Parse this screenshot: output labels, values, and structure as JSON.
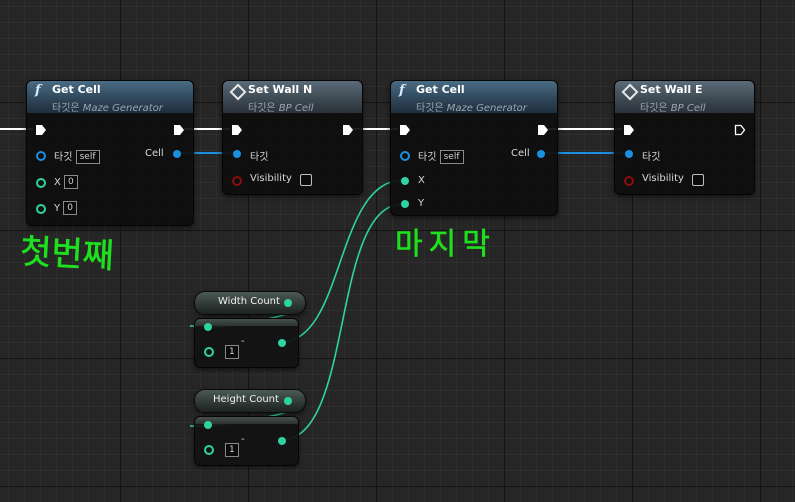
{
  "nodes": {
    "get_cell_1": {
      "title": "Get Cell",
      "target_of": "타깃은",
      "class": "Maze Generator",
      "pins": {
        "target": "타깃",
        "target_value": "self",
        "x": "X",
        "x_value": "0",
        "y": "Y",
        "y_value": "0",
        "out": "Cell"
      }
    },
    "set_wall_n": {
      "title": "Set Wall N",
      "target_of": "타깃은",
      "class": "BP Cell",
      "pins": {
        "target": "타깃",
        "visibility": "Visibility"
      }
    },
    "get_cell_2": {
      "title": "Get Cell",
      "target_of": "타깃은",
      "class": "Maze Generator",
      "pins": {
        "target": "타깃",
        "target_value": "self",
        "x": "X",
        "y": "Y",
        "out": "Cell"
      }
    },
    "set_wall_e": {
      "title": "Set Wall E",
      "target_of": "타깃은",
      "class": "BP Cell",
      "pins": {
        "target": "타깃",
        "visibility": "Visibility"
      }
    },
    "width_count": {
      "label": "Width Count"
    },
    "height_count": {
      "label": "Height Count"
    },
    "subtract_1": {
      "operator": "-",
      "value": "1"
    },
    "subtract_2": {
      "operator": "-",
      "value": "1"
    }
  },
  "annotations": {
    "first": "첫번째",
    "last": "마지막",
    "color": "#1ee01e"
  },
  "colors": {
    "background": "#262626",
    "exec_wire": "#ffffff",
    "object_wire": "#1b8fe0",
    "integer_wire": "#2fd3a3",
    "bool_pin": "#8a0e0e"
  },
  "icons": {
    "function": "function-icon",
    "event_call": "diamond-icon"
  }
}
